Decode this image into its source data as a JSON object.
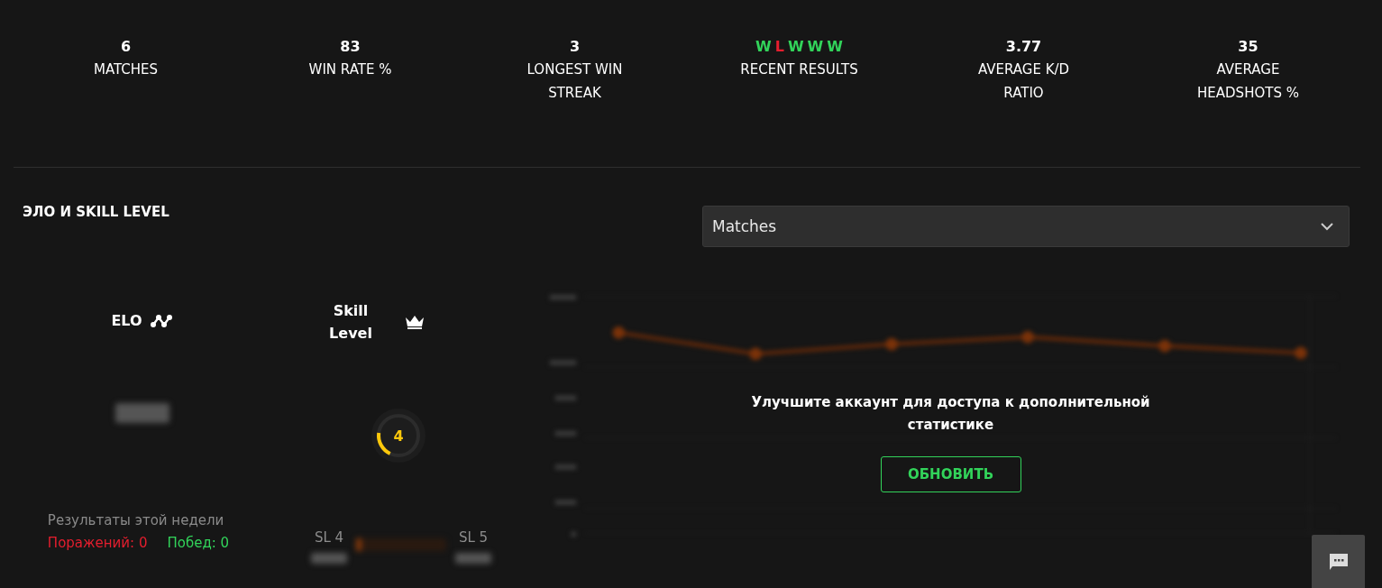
{
  "stats": [
    {
      "kind": "value",
      "value": "6",
      "label": "MATCHES"
    },
    {
      "kind": "value",
      "value": "83",
      "label": "WIN RATE %"
    },
    {
      "kind": "value",
      "value": "3",
      "label": "LONGEST WIN STREAK"
    },
    {
      "kind": "results",
      "results": [
        {
          "text": "W",
          "color": "#32d35a"
        },
        {
          "text": "L",
          "color": "#e51e2e"
        },
        {
          "text": "W",
          "color": "#32d35a"
        },
        {
          "text": "W",
          "color": "#32d35a"
        },
        {
          "text": "W",
          "color": "#32d35a"
        }
      ],
      "label": "RECENT RESULTS"
    },
    {
      "kind": "value",
      "value": "3.77",
      "label": "AVERAGE K/D RATIO"
    },
    {
      "kind": "value",
      "value": "35",
      "label": "AVERAGE HEADSHOTS %"
    }
  ],
  "section_title": "ЭЛО И SKILL LEVEL",
  "dropdown": {
    "value": "Matches"
  },
  "elo": {
    "title": "ELO"
  },
  "skill": {
    "title": "Skill Level",
    "level_text": "4",
    "level": 0.2,
    "from": "SL 4",
    "to": "SL 5",
    "progress": {
      "level": 0.06
    }
  },
  "weekly": {
    "title": "Результаты этой недели",
    "losses": "Поражений: 0",
    "wins": "Побед: 0"
  },
  "upgrade": {
    "message": "Улучшите аккаунт для доступа к дополнительной статистике",
    "button": "ОБНОВИТЬ"
  }
}
